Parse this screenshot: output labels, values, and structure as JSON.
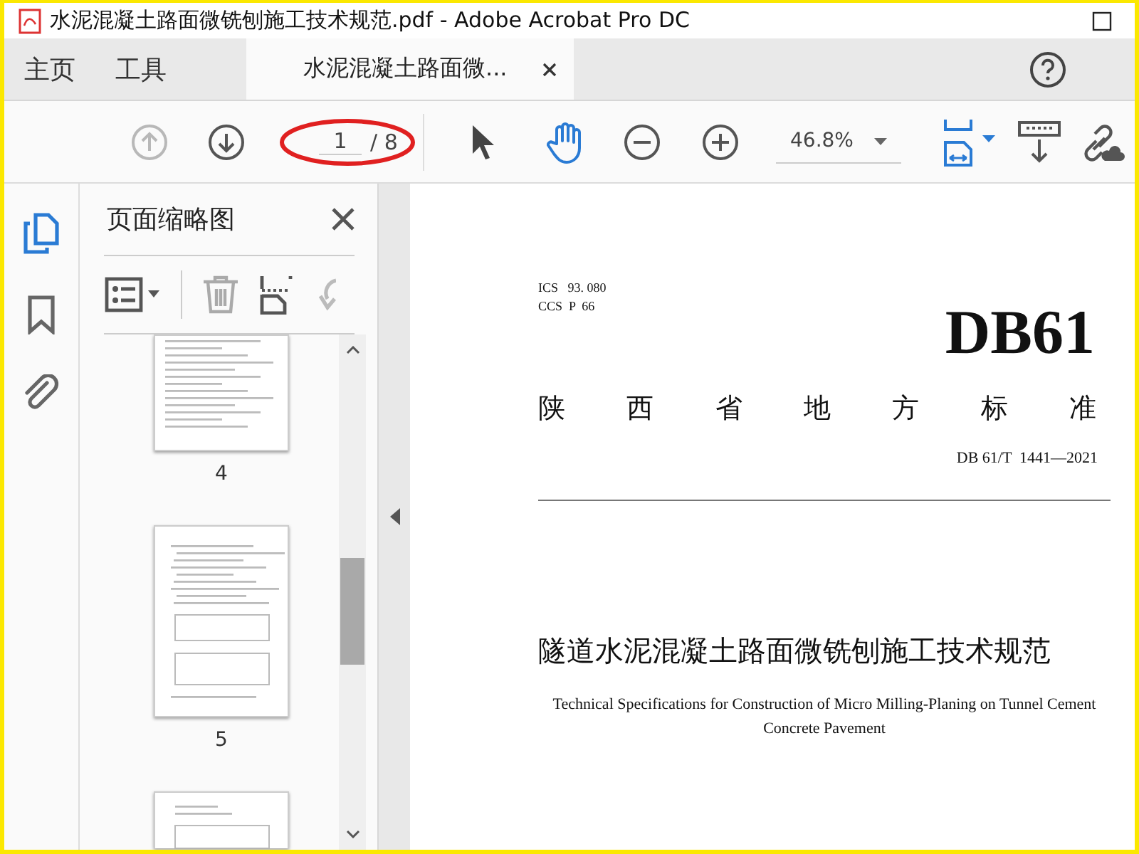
{
  "window": {
    "title": "水泥混凝土路面微铣刨施工技术规范.pdf - Adobe Acrobat Pro DC"
  },
  "tabs": [
    {
      "label": "主页",
      "selected": false
    },
    {
      "label": "工具",
      "selected": false
    },
    {
      "label": "水泥混凝土路面微...",
      "selected": true
    }
  ],
  "toolbar": {
    "nav": [
      {
        "kind": "previous",
        "disabled": true
      },
      {
        "kind": "next",
        "disabled": false
      }
    ],
    "page_field": {
      "value": "1",
      "total": "/ 8"
    },
    "tools": [
      {
        "kind": "select",
        "selected": false
      },
      {
        "kind": "hand",
        "selected": true
      }
    ],
    "zoom": {
      "value": "46.8%"
    }
  },
  "sidebar": {
    "items": [
      {
        "kind": "pages",
        "selected": true
      },
      {
        "kind": "bookmarks",
        "selected": false
      },
      {
        "kind": "attachments",
        "selected": false
      }
    ]
  },
  "panel": {
    "title": "页面缩略图",
    "thumbnails": [
      {
        "label": "4"
      },
      {
        "label": "5"
      }
    ]
  },
  "document": {
    "codes": [
      "ICS   93. 080",
      "CCS  P  66"
    ],
    "logo": "DB61",
    "heading": "陕 西 省 地 方 标 准",
    "number": "DB 61/T  1441—2021",
    "title": "隧道水泥混凝土路面微铣刨施工技术规范",
    "subtitle": "Technical Specifications for Construction of Micro Milling-Planing on Tunnel Cement Concrete Pavement"
  }
}
